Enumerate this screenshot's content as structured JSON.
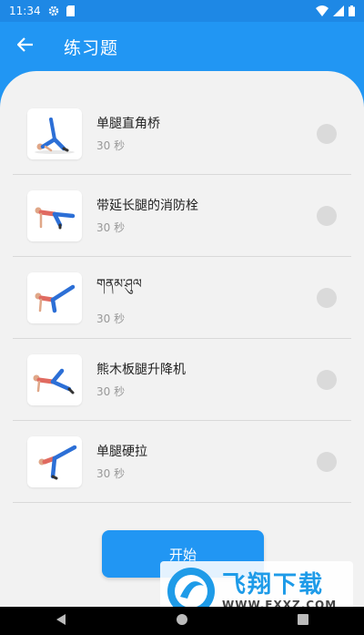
{
  "status_bar": {
    "time": "11:34",
    "icons": [
      "settings-icon",
      "sd-card-icon",
      "wifi-icon",
      "signal-icon",
      "battery-icon"
    ]
  },
  "app_bar": {
    "title": "练习题",
    "back_icon": "arrow-left-icon"
  },
  "exercises": [
    {
      "name": "单腿直角桥",
      "duration": "30 秒",
      "selected": false
    },
    {
      "name": "带延长腿的消防栓",
      "duration": "30 秒",
      "selected": false
    },
    {
      "name": "གནམ་ཤུལ",
      "duration": "30 秒",
      "selected": false
    },
    {
      "name": "熊木板腿升降机",
      "duration": "30 秒",
      "selected": false
    },
    {
      "name": "单腿硬拉",
      "duration": "30 秒",
      "selected": false
    }
  ],
  "start_button": {
    "label": "开始"
  },
  "watermark": {
    "title": "飞翔下载",
    "url": "WWW.FXXZ.COM"
  },
  "nav_bar": {
    "icons": [
      "back-triangle-icon",
      "home-circle-icon",
      "recents-square-icon"
    ]
  },
  "colors": {
    "primary": "#2196F3",
    "background": "#F2F2F2",
    "radio_unselected": "#DADADA",
    "exercise_outfit": "#2C6FD6"
  }
}
